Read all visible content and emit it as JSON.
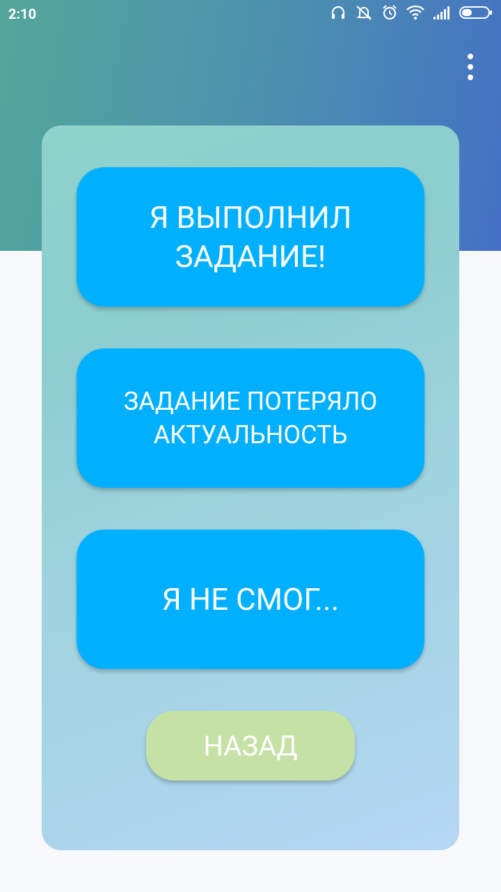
{
  "status_bar": {
    "time": "2:10",
    "icons": [
      "headphones-icon",
      "mute-icon",
      "alarm-icon",
      "wifi-icon",
      "signal-icon",
      "battery-icon"
    ]
  },
  "toolbar": {
    "menu_icon": "more-vert-icon"
  },
  "card": {
    "buttons": [
      {
        "label": "Я ВЫПОЛНИЛ ЗАДАНИЕ!"
      },
      {
        "label": "ЗАДАНИЕ ПОТЕРЯЛО АКТУАЛЬНОСТЬ"
      },
      {
        "label": "Я НЕ СМОГ..."
      }
    ],
    "back_label": "НАЗАД"
  },
  "colors": {
    "header_gradient_start": "#53a79a",
    "header_gradient_end": "#4470c4",
    "action_button": "#00b0ff",
    "back_button": "#c5e1a5",
    "page_background": "#f7f8f9"
  }
}
